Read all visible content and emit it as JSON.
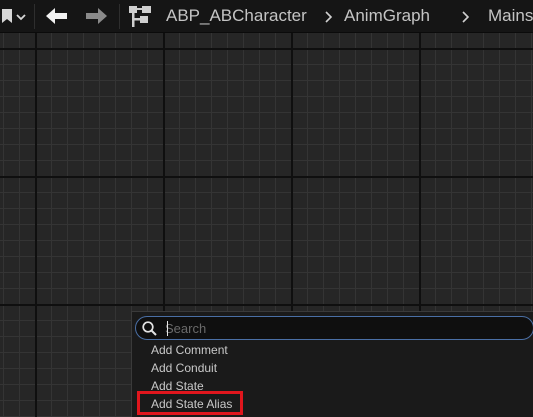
{
  "toolbar": {
    "icons": {
      "bookmark": "bookmark-icon",
      "dropdown": "chevron-down-icon",
      "back": "arrow-left-icon",
      "forward": "arrow-right-icon",
      "graph": "graph-hierarchy-icon"
    }
  },
  "breadcrumb": {
    "items": [
      "ABP_ABCharacter",
      "AnimGraph",
      "Mains"
    ]
  },
  "context_menu": {
    "search": {
      "value": "",
      "placeholder": "Search"
    },
    "items": [
      {
        "label": "Add Comment"
      },
      {
        "label": "Add Conduit"
      },
      {
        "label": "Add State"
      },
      {
        "label": "Add State Alias"
      }
    ],
    "highlight_color": "#e0161d"
  },
  "colors": {
    "grid_background": "#262626",
    "toolbar_background": "#151515",
    "search_border": "#4a6fa5"
  }
}
